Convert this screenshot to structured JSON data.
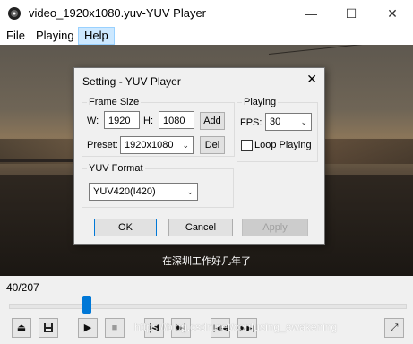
{
  "window": {
    "title": "video_1920x1080.yuv-YUV Player",
    "minimize": "—",
    "maximize": "☐",
    "close": "✕"
  },
  "menu": {
    "file": "File",
    "playing": "Playing",
    "help": "Help"
  },
  "video": {
    "subtitle": "在深圳工作好几年了"
  },
  "status": {
    "frame_counter": "40/207",
    "seek_position": 0.19
  },
  "watermark": "https://blog.csdn.net/confusing_awakening",
  "toolbar": {
    "eject": "⏏",
    "save": "💾",
    "play": "▶",
    "stop": "■",
    "first": "|◀",
    "step_fwd": "▶|",
    "prev_frame": "|◀◀",
    "next_frame": "▶▶|",
    "settings": "⤢"
  },
  "dialog": {
    "title": "Setting - YUV Player",
    "close": "✕",
    "frame_size": {
      "label": "Frame Size",
      "w_label": "W:",
      "w_value": "1920",
      "h_label": "H:",
      "h_value": "1080",
      "add": "Add",
      "del": "Del",
      "preset_label": "Preset:",
      "preset_value": "1920x1080"
    },
    "playing": {
      "label": "Playing",
      "fps_label": "FPS:",
      "fps_value": "30",
      "loop_label": "Loop Playing",
      "loop_checked": false
    },
    "yuv_format": {
      "label": "YUV Format",
      "value": "YUV420(I420)"
    },
    "buttons": {
      "ok": "OK",
      "cancel": "Cancel",
      "apply": "Apply"
    }
  }
}
